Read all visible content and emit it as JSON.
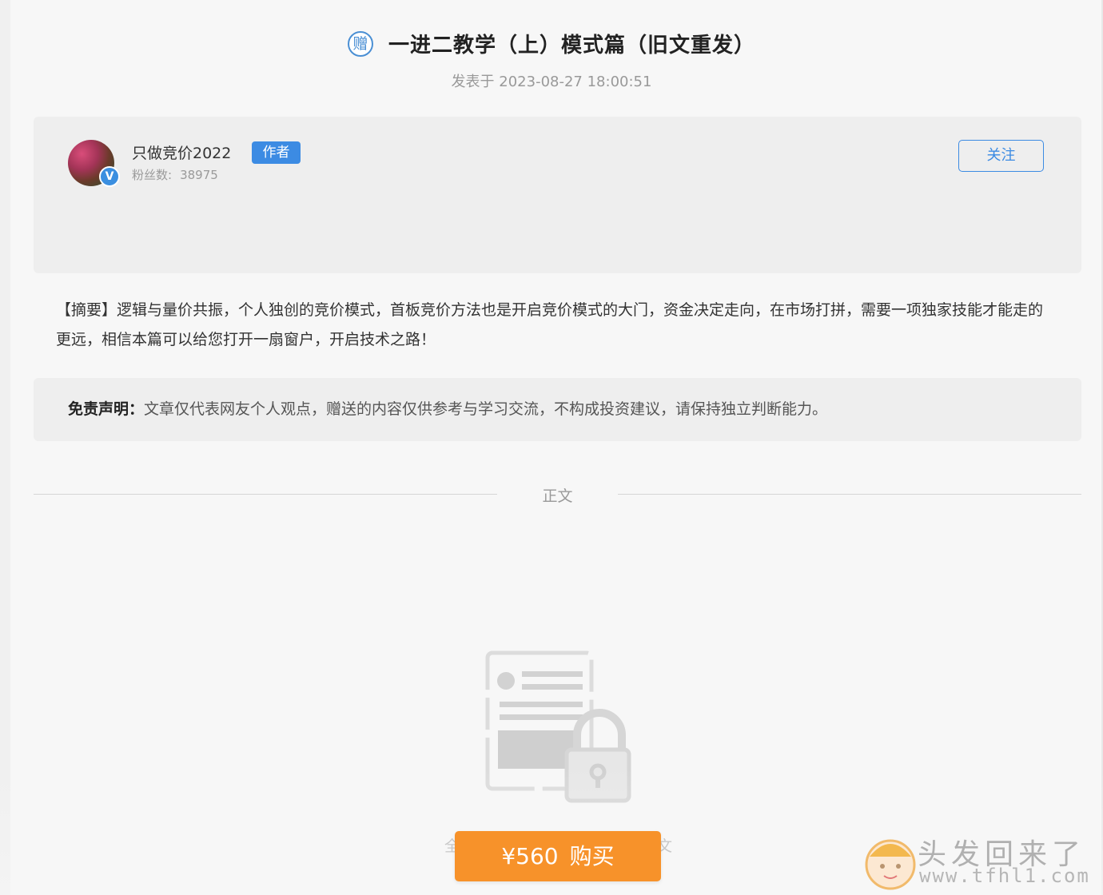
{
  "article": {
    "gift_badge": "赠",
    "title": "一进二教学（上）模式篇（旧文重发）",
    "publish_time": "发表于 2023-08-27 18:00:51"
  },
  "author": {
    "name": "只做竞价2022",
    "badge": "作者",
    "fans_label": "粉丝数:",
    "fans_count": "38975",
    "verified_mark": "V",
    "follow_label": "关注"
  },
  "summary": "【摘要】逻辑与量价共振，个人独创的竞价模式，首板竞价方法也是开启竞价模式的大门，资金决定走向，在市场打拼，需要一项独家技能才能走的更远，相信本篇可以给您打开一扇窗户，开启技术之路！",
  "disclaimer": {
    "label": "免责声明：",
    "text": "文章仅代表网友个人观点，赠送的内容仅供参考与学习交流，不构成投资建议，请保持独立判断能力。"
  },
  "divider_label": "正文",
  "paywall": {
    "icon": "locked-document-icon",
    "hint_left": "全",
    "hint_right": "文",
    "price": "¥560",
    "buy_label": "购买"
  },
  "watermark": {
    "text": "头发回来了",
    "url": "www.tfhl1.com"
  },
  "colors": {
    "accent_blue": "#3c8be3",
    "buy_orange": "#f7922a",
    "card_bg": "#eeeeee",
    "page_bg": "#f7f7f7"
  }
}
